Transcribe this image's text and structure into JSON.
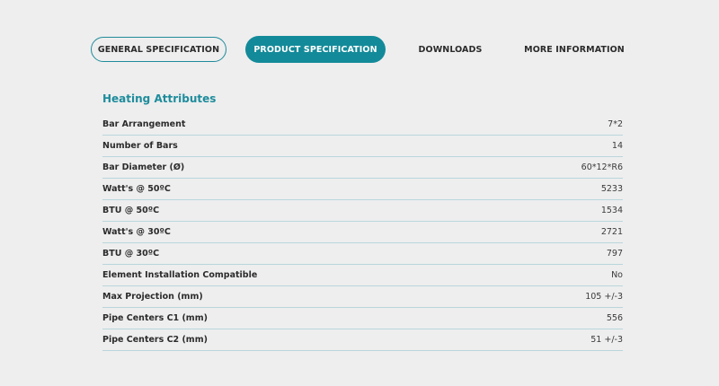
{
  "tabs": [
    {
      "label": "GENERAL SPECIFICATION"
    },
    {
      "label": "PRODUCT SPECIFICATION"
    },
    {
      "label": "DOWNLOADS"
    },
    {
      "label": "MORE INFORMATION"
    }
  ],
  "active_tab": "PRODUCT SPECIFICATION",
  "section": {
    "title": "Heating Attributes",
    "rows": [
      {
        "label": "Bar Arrangement",
        "value": "7*2"
      },
      {
        "label": "Number of Bars",
        "value": "14"
      },
      {
        "label": "Bar Diameter (Ø)",
        "value": "60*12*R6"
      },
      {
        "label": "Watt's @ 50ºC",
        "value": "5233"
      },
      {
        "label": "BTU @ 50ºC",
        "value": "1534"
      },
      {
        "label": "Watt's @ 30ºC",
        "value": "2721"
      },
      {
        "label": "BTU @ 30ºC",
        "value": "797"
      },
      {
        "label": "Element Installation Compatible",
        "value": "No"
      },
      {
        "label": "Max Projection (mm)",
        "value": "105 +/-3"
      },
      {
        "label": "Pipe Centers C1 (mm)",
        "value": "556"
      },
      {
        "label": "Pipe Centers C2 (mm)",
        "value": "51 +/-3"
      }
    ]
  },
  "colors": {
    "accent": "#138a99",
    "background": "#eeeeee",
    "divider": "#b9d6dc"
  }
}
